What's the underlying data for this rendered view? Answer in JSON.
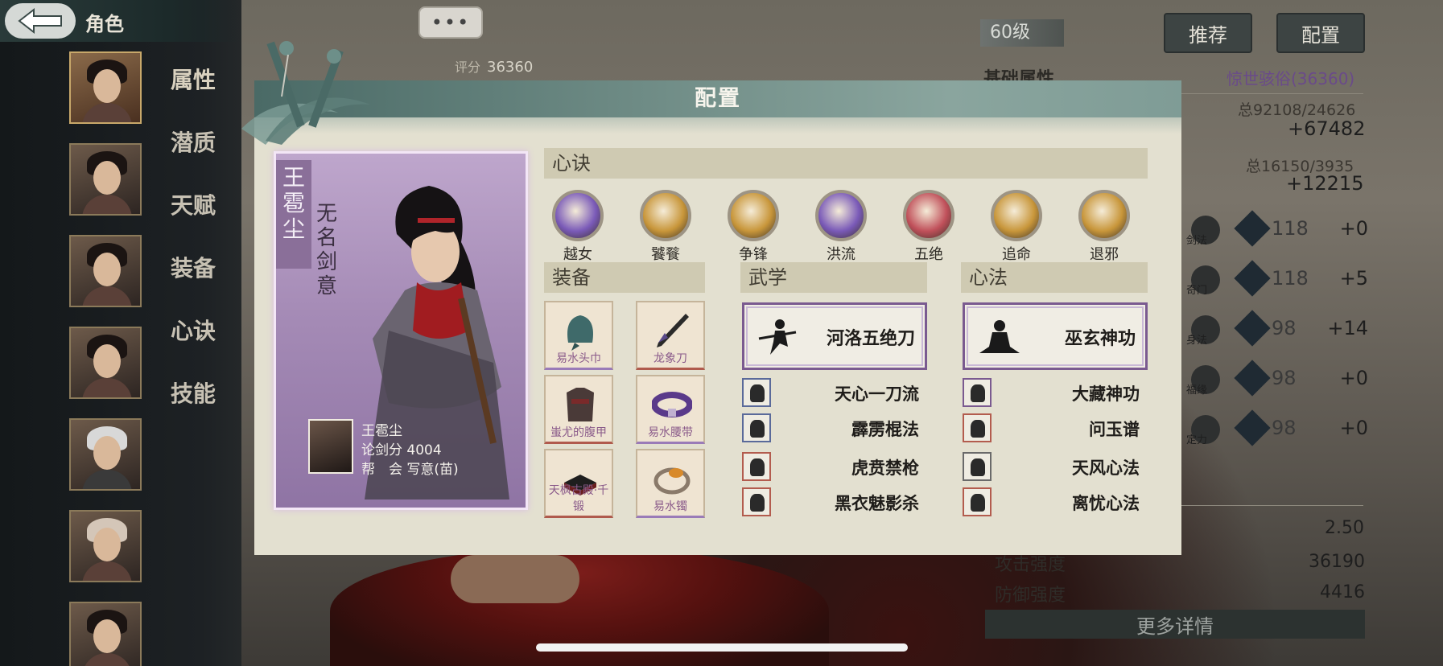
{
  "header": {
    "title": "角色",
    "chat_label": "•••"
  },
  "side_menu": [
    "属性",
    "潜质",
    "天赋",
    "装备",
    "心诀",
    "技能"
  ],
  "score": {
    "label": "评分",
    "value": "36360"
  },
  "right_panel": {
    "level": "60级",
    "recommend": "推荐",
    "config": "配置",
    "base_attr": "基础属性",
    "title_link": "惊世骇俗(36360)",
    "total1": "总92108/24626",
    "delta1": "+67482",
    "total2": "总16150/3935",
    "delta2": "+12215",
    "stats": [
      {
        "name": "剑法",
        "value": "118",
        "delta": "+0"
      },
      {
        "name": "奇门",
        "value": "118",
        "delta": "+5"
      },
      {
        "name": "身法",
        "value": "98",
        "delta": "+14"
      },
      {
        "name": "福缘",
        "value": "98",
        "delta": "+0"
      },
      {
        "name": "定力",
        "value": "98",
        "delta": "+0"
      }
    ],
    "val_250": "2.50",
    "attack_label": "攻击强度",
    "attack_value": "36190",
    "defense_label": "防御强度",
    "defense_value": "4416",
    "more_details": "更多详情"
  },
  "modal": {
    "title": "配置",
    "character": {
      "name": "王雹尘",
      "title": "无名剑意",
      "info_name": "王雹尘",
      "sword_score": "论剑分 4004",
      "guild": "帮　会 写意(苗)"
    },
    "mind_section": "心诀",
    "minds": [
      {
        "label": "越女",
        "color": "#7a5ab8"
      },
      {
        "label": "饕餮",
        "color": "#c8963a"
      },
      {
        "label": "争锋",
        "color": "#c8963a"
      },
      {
        "label": "洪流",
        "color": "#7a5ab8"
      },
      {
        "label": "五绝",
        "color": "#c0505a"
      },
      {
        "label": "追命",
        "color": "#c8963a"
      },
      {
        "label": "退邪",
        "color": "#c8963a"
      }
    ],
    "equip_section": "装备",
    "equips": [
      {
        "label": "易水头巾",
        "rarity": "purple"
      },
      {
        "label": "龙象刀",
        "rarity": "red"
      },
      {
        "label": "蚩尤的腹甲",
        "rarity": "red"
      },
      {
        "label": "易水腰带",
        "rarity": "purple"
      },
      {
        "label": "天枫古殿·千锻",
        "rarity": "red"
      },
      {
        "label": "易水镯",
        "rarity": "purple"
      }
    ],
    "martial_section": "武学",
    "martial_main": "河洛五绝刀",
    "martial_list": [
      "天心一刀流",
      "霹雳棍法",
      "虎贲禁枪",
      "黑衣魅影杀"
    ],
    "inner_section": "心法",
    "inner_main": "巫玄神功",
    "inner_list": [
      "大藏神功",
      "问玉谱",
      "天风心法",
      "离忧心法"
    ]
  }
}
